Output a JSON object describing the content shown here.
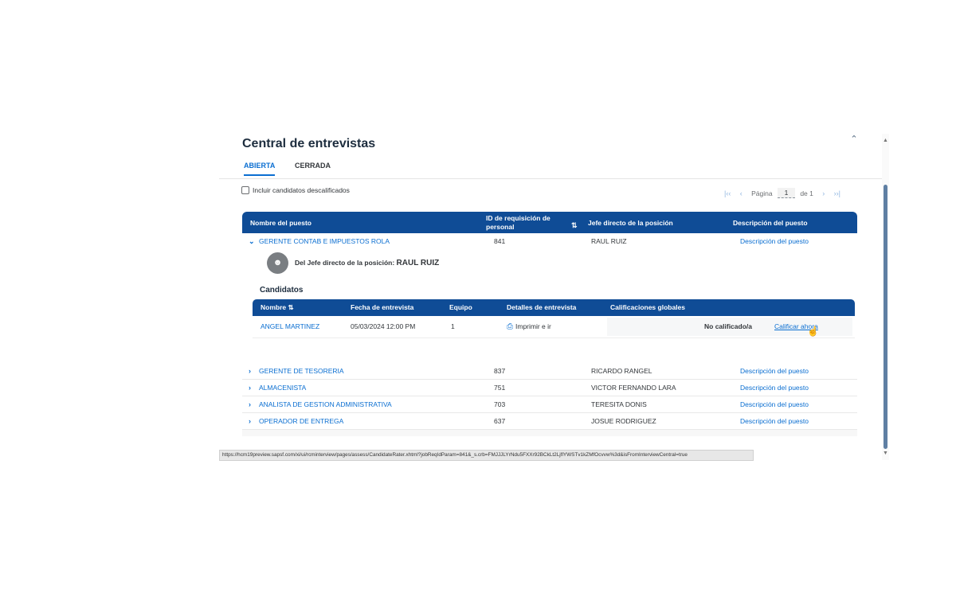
{
  "page": {
    "title": "Central de entrevistas",
    "collapse_icon": "chevron-up-icon",
    "tabs": [
      {
        "label": "ABIERTA",
        "active": true
      },
      {
        "label": "CERRADA",
        "active": false
      }
    ],
    "include_disqualified_label": "Incluir candidatos descalificados",
    "include_disqualified_checked": false
  },
  "pager": {
    "page_label": "Página",
    "page_value": "1",
    "of_label": "de 1"
  },
  "table": {
    "headers": {
      "job_title": "Nombre del puesto",
      "requisition_id": "ID de requisición de personal",
      "manager": "Jefe directo de la posición",
      "description": "Descripción del puesto"
    },
    "expanded_row": {
      "job_title": "GERENTE CONTAB E IMPUESTOS ROLA",
      "requisition_id": "841",
      "manager": "RAUL RUIZ",
      "description": "Descripción del puesto",
      "manager_label": "Del Jefe directo de la posición:",
      "manager_name": "RAUL RUIZ",
      "candidates_heading": "Candidatos",
      "candidates_headers": {
        "name": "Nombre",
        "date": "Fecha de entrevista",
        "team": "Equipo",
        "details": "Detalles de entrevista",
        "ratings": "Calificaciones globales"
      },
      "candidates": [
        {
          "name": "ANGEL MARTINEZ",
          "date": "05/03/2024 12:00 PM",
          "team": "1",
          "details": "Imprimir e ir",
          "status": "No calificado/a",
          "action": "Calificar ahora"
        }
      ]
    },
    "rows": [
      {
        "job_title": "GERENTE DE TESORERIA",
        "requisition_id": "837",
        "manager": "RICARDO RANGEL",
        "description": "Descripción del puesto"
      },
      {
        "job_title": "ALMACENISTA",
        "requisition_id": "751",
        "manager": "VICTOR FERNANDO LARA",
        "description": "Descripción del puesto"
      },
      {
        "job_title": "ANALISTA DE GESTION ADMINISTRATIVA",
        "requisition_id": "703",
        "manager": "TERESITA DONIS",
        "description": "Descripción del puesto"
      },
      {
        "job_title": "OPERADOR DE ENTREGA",
        "requisition_id": "637",
        "manager": "JOSUE RODRIGUEZ",
        "description": "Descripción del puesto"
      }
    ]
  },
  "status_bar": {
    "url": "https://hcm19preview.sapsf.com/xi/ui/rcminterview/pages/assess/CandidateRater.xhtml?jobReqIdParam=841&_s.crb=FMJJJLYrNdu5FXXr92BCkLt2LjflYWSTv1kZMfOcvvw%3d&isFromInterviewCentral=true"
  },
  "colors": {
    "header_bg": "#0f4c96",
    "link": "#0a6ed1",
    "text": "#32363a"
  }
}
